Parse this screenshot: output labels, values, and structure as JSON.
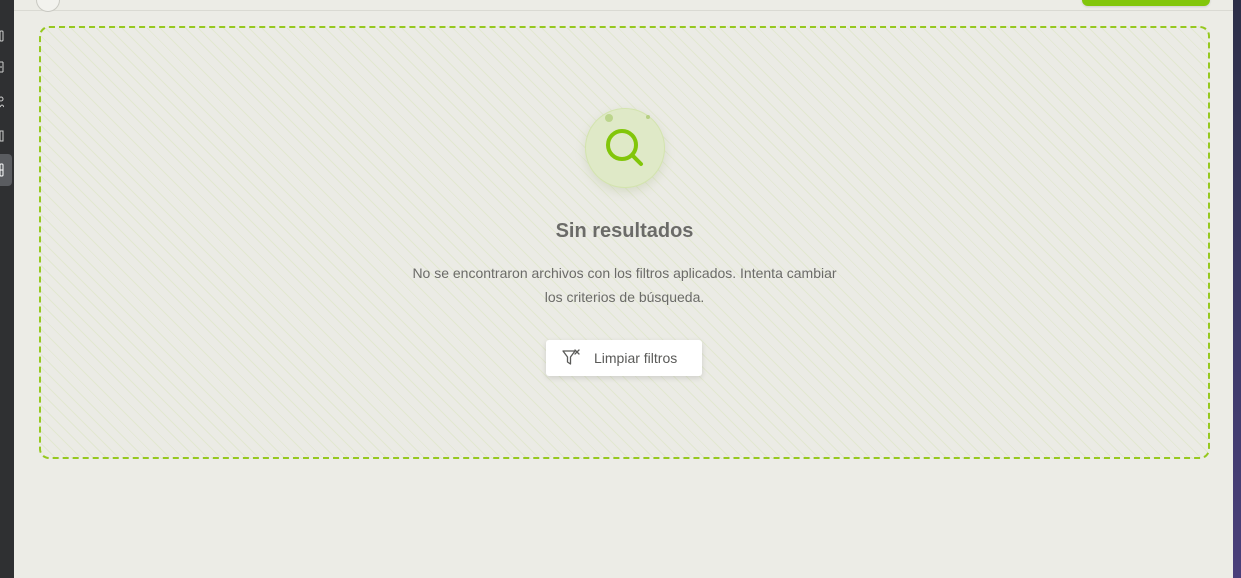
{
  "empty_state": {
    "icon": "search-icon",
    "title": "Sin resultados",
    "description": "No se encontraron archivos con los filtros aplicados. Intenta cambiar los criterios de búsqueda.",
    "clear_button_label": "Limpiar filtros",
    "clear_button_icon": "filter-clear-icon"
  },
  "colors": {
    "accent": "#82c60a",
    "dashed_border": "#96c81f",
    "background": "#ecece6",
    "text_muted": "#6b6b68"
  }
}
